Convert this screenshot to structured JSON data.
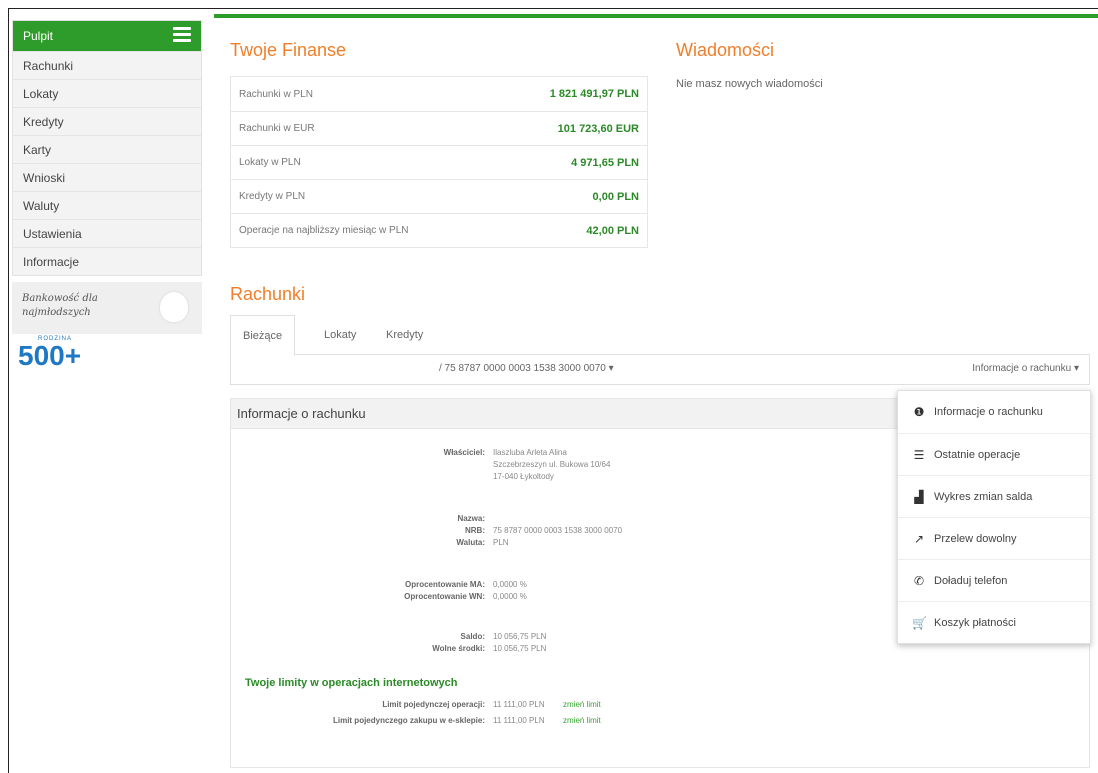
{
  "sidebar": {
    "items": [
      {
        "label": "Pulpit"
      },
      {
        "label": "Rachunki"
      },
      {
        "label": "Lokaty"
      },
      {
        "label": "Kredyty"
      },
      {
        "label": "Karty"
      },
      {
        "label": "Wnioski"
      },
      {
        "label": "Waluty"
      },
      {
        "label": "Ustawienia"
      },
      {
        "label": "Informacje"
      }
    ],
    "promo_text": "Bankowość dla najmłodszych",
    "logo_text": "500+",
    "logo_small": "RODZINA"
  },
  "finance": {
    "title": "Twoje Finanse",
    "rows": [
      {
        "label": "Rachunki w PLN",
        "value": "1 821 491,97 PLN"
      },
      {
        "label": "Rachunki w EUR",
        "value": "101 723,60 EUR"
      },
      {
        "label": "Lokaty w PLN",
        "value": "4 971,65 PLN"
      },
      {
        "label": "Kredyty w PLN",
        "value": "0,00 PLN"
      },
      {
        "label": "Operacje na najbliższy miesiąc w PLN",
        "value": "42,00 PLN"
      }
    ]
  },
  "messages": {
    "title": "Wiadomości",
    "text": "Nie masz nowych wiadomości"
  },
  "accounts": {
    "title": "Rachunki",
    "tabs": [
      {
        "label": "Bieżące"
      },
      {
        "label": "Lokaty"
      },
      {
        "label": "Kredyty"
      }
    ],
    "selected_account": "/ 75 8787 0000 0003 1538 3000 0070",
    "info_dropdown": "Informacje o rachunku"
  },
  "info_panel": {
    "title": "Informacje o rachunku",
    "owner_label": "Właściciel:",
    "owner_lines": [
      "Ilaszluba Arleta Alina",
      "Szczebrzeszyn ul. Bukowa 10/64",
      "17-040 Łykoltody"
    ],
    "name_label": "Nazwa:",
    "nrb_label": "NRB:",
    "nrb_value": "75 8787 0000 0003 1538 3000 0070",
    "currency_label": "Waluta:",
    "currency_value": "PLN",
    "rate_ma_label": "Oprocentowanie MA:",
    "rate_ma_value": "0,0000 %",
    "rate_wn_label": "Oprocentowanie WN:",
    "rate_wn_value": "0,0000 %",
    "balance_label": "Saldo:",
    "balance_value": "10 056,75 PLN",
    "available_label": "Wolne środki:",
    "available_value": "10 056,75 PLN",
    "limits_title": "Twoje limity w operacjach internetowych",
    "limit_single_label": "Limit pojedynczej operacji:",
    "limit_single_value": "11 111,00 PLN",
    "limit_shop_label": "Limit pojedynczego zakupu w e-sklepie:",
    "limit_shop_value": "11 111,00 PLN",
    "change_limit": "zmień limit"
  },
  "dropdown": {
    "items": [
      {
        "label": "Informacje o rachunku",
        "icon": "info-icon"
      },
      {
        "label": "Ostatnie operacje",
        "icon": "list-icon"
      },
      {
        "label": "Wykres zmian salda",
        "icon": "bar-chart-icon"
      },
      {
        "label": "Przelew dowolny",
        "icon": "external-transfer-icon"
      },
      {
        "label": "Doładuj telefon",
        "icon": "phone-icon"
      },
      {
        "label": "Koszyk płatności",
        "icon": "cart-icon"
      }
    ]
  },
  "colors": {
    "accent_green": "#2e9c2a",
    "title_orange": "#f07e2a",
    "value_green": "#2b8a27"
  }
}
